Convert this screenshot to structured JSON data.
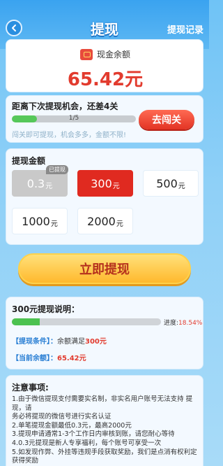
{
  "header": {
    "title": "提现",
    "record_link": "提现记录",
    "back_icon": "chevron-left-icon"
  },
  "balance": {
    "label": "现金余额",
    "value": "65.42元",
    "icon": "wallet-icon"
  },
  "chance": {
    "title": "距离下次提现机会，还差4关",
    "progress_text": "1/5",
    "progress_fraction": 0.2,
    "note": "闯关即可提现，机会多多，金额不限!",
    "button_label": "去闯关"
  },
  "amount": {
    "title": "提现金额",
    "options": [
      {
        "num": "0.3",
        "unit": "元",
        "state": "disabled",
        "tag": "已提现"
      },
      {
        "num": "300",
        "unit": "元",
        "state": "selected",
        "tag": ""
      },
      {
        "num": "500",
        "unit": "元",
        "state": "normal",
        "tag": ""
      },
      {
        "num": "1000",
        "unit": "元",
        "state": "normal",
        "tag": ""
      },
      {
        "num": "2000",
        "unit": "元",
        "state": "normal",
        "tag": ""
      }
    ]
  },
  "withdraw_button": "立即提现",
  "description": {
    "title": "300元提现说明：",
    "progress_label": "进度:",
    "progress_pct": "18.54%",
    "progress_fraction": 0.1854,
    "condition_key": "【提现条件】：",
    "condition_text": "余额满足",
    "condition_value": "300元",
    "current_key": "【当前余额】：",
    "current_value": "65.42元"
  },
  "notes": {
    "title": "注意事项:",
    "items": [
      "1.由于微信提现支付需要实名制，非实名用户账号无法支持 提现，请",
      "务必将提现的微信号进行实名认证",
      "2.单笔提现金额最低0.3元，最高2000元",
      "3.提现申请通常1-3个工作日内审核到账，请您耐心等待",
      "4.0.3元提现是新人专享福利，每个账号可享受一次",
      "5.如发现作弊、外挂等违规手段获取奖励，我们是点消有权利定获得奖励"
    ]
  },
  "colors": {
    "accent_red": "#e23b2e",
    "progress_green": "#56c85a",
    "button_yellow": "#ffc53d",
    "header_blue": "#3aa3f0"
  }
}
